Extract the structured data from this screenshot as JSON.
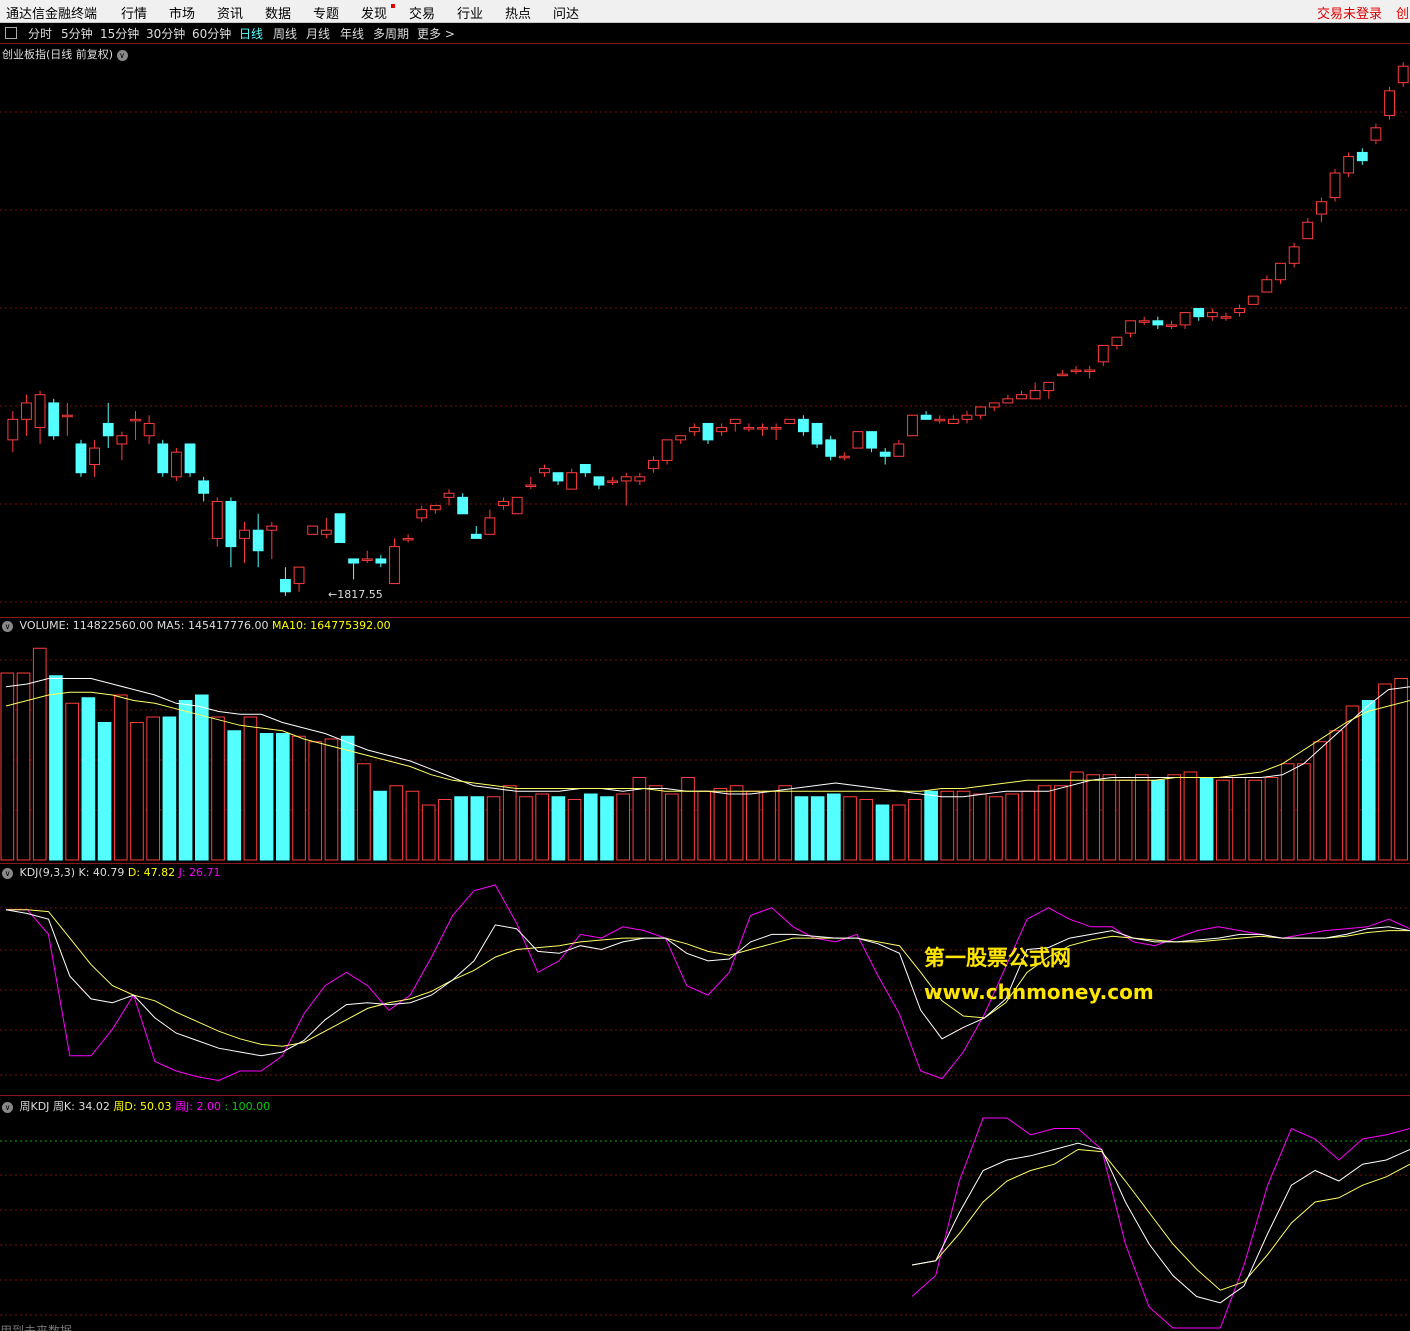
{
  "menubar": {
    "app_title": "通达信金融终端",
    "items": [
      "行情",
      "市场",
      "资讯",
      "数据",
      "专题",
      "发现",
      "交易",
      "行业",
      "热点",
      "问达"
    ],
    "login": "交易未登录",
    "right_cut": "创业"
  },
  "periods": {
    "items": [
      "分时",
      "5分钟",
      "15分钟",
      "30分钟",
      "60分钟",
      "日线",
      "周线",
      "月线",
      "年线",
      "多周期",
      "更多 >"
    ],
    "active": "日线"
  },
  "main_pane": {
    "title": "创业板指(日线 前复权)",
    "low_label": "←1817.55"
  },
  "volume_pane": {
    "label": "VOLUME: 114822560.00",
    "ma5": "MA5: 145417776.00",
    "ma10": "MA10: 164775392.00"
  },
  "kdj_pane": {
    "label": "KDJ(9,3,3)",
    "k": "K: 40.79",
    "d": "D: 47.82",
    "j": "J: 26.71"
  },
  "weekly_kdj_pane": {
    "label": "周KDJ",
    "k": "周K: 34.02",
    "d": "周D: 50.03",
    "j": "周J: 2.00",
    "ref": ": 100.00"
  },
  "watermark": {
    "line1": "第一股票公式网",
    "line2": "www.chnmoney.com"
  },
  "statusbar": {
    "text": "用到未来数据"
  },
  "colors": {
    "up": "#ff3c3c",
    "down": "#54ffff",
    "k_line": "#ffffff",
    "d_line": "#ffff66",
    "j_line": "#ff00ff",
    "grid": "#7a1010",
    "ref_line": "#00aa00"
  },
  "chart_data": [
    {
      "type": "candlestick",
      "name": "price",
      "low_annotation": 1817.55,
      "candles": [
        [
          0.57,
          0.62,
          0.64,
          0.54
        ],
        [
          0.62,
          0.66,
          0.68,
          0.58
        ],
        [
          0.6,
          0.68,
          0.69,
          0.56
        ],
        [
          0.66,
          0.58,
          0.67,
          0.57
        ],
        [
          0.63,
          0.63,
          0.66,
          0.58
        ],
        [
          0.56,
          0.49,
          0.57,
          0.48
        ],
        [
          0.51,
          0.55,
          0.57,
          0.48
        ],
        [
          0.61,
          0.58,
          0.66,
          0.55
        ],
        [
          0.56,
          0.58,
          0.59,
          0.52
        ],
        [
          0.62,
          0.62,
          0.64,
          0.57
        ],
        [
          0.58,
          0.61,
          0.63,
          0.56
        ],
        [
          0.56,
          0.49,
          0.57,
          0.48
        ],
        [
          0.48,
          0.54,
          0.55,
          0.47
        ],
        [
          0.56,
          0.49,
          0.56,
          0.48
        ],
        [
          0.47,
          0.44,
          0.48,
          0.42
        ],
        [
          0.33,
          0.42,
          0.43,
          0.31
        ],
        [
          0.42,
          0.31,
          0.43,
          0.26
        ],
        [
          0.33,
          0.35,
          0.37,
          0.27
        ],
        [
          0.35,
          0.3,
          0.39,
          0.26
        ],
        [
          0.35,
          0.36,
          0.37,
          0.28
        ],
        [
          0.23,
          0.2,
          0.26,
          0.19
        ],
        [
          0.22,
          0.26,
          0.26,
          0.2
        ],
        [
          0.34,
          0.36,
          0.36,
          0.34
        ],
        [
          0.34,
          0.35,
          0.38,
          0.33
        ],
        [
          0.39,
          0.32,
          0.39,
          0.32
        ],
        [
          0.28,
          0.27,
          0.28,
          0.23
        ],
        [
          0.28,
          0.28,
          0.3,
          0.27
        ],
        [
          0.28,
          0.27,
          0.29,
          0.26
        ],
        [
          0.22,
          0.31,
          0.33,
          0.22
        ],
        [
          0.33,
          0.33,
          0.34,
          0.32
        ],
        [
          0.38,
          0.4,
          0.41,
          0.37
        ],
        [
          0.4,
          0.41,
          0.41,
          0.39
        ],
        [
          0.43,
          0.44,
          0.45,
          0.41
        ],
        [
          0.43,
          0.39,
          0.44,
          0.39
        ],
        [
          0.34,
          0.33,
          0.36,
          0.33
        ],
        [
          0.34,
          0.38,
          0.4,
          0.34
        ],
        [
          0.41,
          0.42,
          0.43,
          0.4
        ],
        [
          0.39,
          0.43,
          0.43,
          0.39
        ],
        [
          0.46,
          0.46,
          0.48,
          0.45
        ],
        [
          0.49,
          0.5,
          0.51,
          0.48
        ],
        [
          0.49,
          0.47,
          0.49,
          0.46
        ],
        [
          0.45,
          0.49,
          0.5,
          0.45
        ],
        [
          0.51,
          0.49,
          0.51,
          0.48
        ],
        [
          0.48,
          0.46,
          0.48,
          0.45
        ],
        [
          0.47,
          0.47,
          0.48,
          0.46
        ],
        [
          0.47,
          0.48,
          0.49,
          0.41
        ],
        [
          0.47,
          0.48,
          0.49,
          0.46
        ],
        [
          0.5,
          0.52,
          0.53,
          0.49
        ],
        [
          0.52,
          0.57,
          0.57,
          0.51
        ],
        [
          0.57,
          0.58,
          0.58,
          0.56
        ],
        [
          0.59,
          0.6,
          0.61,
          0.58
        ],
        [
          0.61,
          0.57,
          0.61,
          0.56
        ],
        [
          0.59,
          0.6,
          0.61,
          0.58
        ],
        [
          0.61,
          0.62,
          0.62,
          0.59
        ],
        [
          0.6,
          0.6,
          0.61,
          0.59
        ],
        [
          0.6,
          0.6,
          0.61,
          0.58
        ],
        [
          0.6,
          0.6,
          0.61,
          0.57
        ],
        [
          0.61,
          0.62,
          0.62,
          0.61
        ],
        [
          0.62,
          0.59,
          0.63,
          0.58
        ],
        [
          0.61,
          0.56,
          0.61,
          0.55
        ],
        [
          0.57,
          0.53,
          0.58,
          0.52
        ],
        [
          0.53,
          0.53,
          0.54,
          0.52
        ],
        [
          0.55,
          0.59,
          0.59,
          0.55
        ],
        [
          0.59,
          0.55,
          0.59,
          0.54
        ],
        [
          0.54,
          0.53,
          0.55,
          0.51
        ],
        [
          0.53,
          0.56,
          0.57,
          0.53
        ],
        [
          0.58,
          0.63,
          0.63,
          0.58
        ],
        [
          0.63,
          0.62,
          0.64,
          0.62
        ],
        [
          0.62,
          0.62,
          0.63,
          0.61
        ],
        [
          0.61,
          0.62,
          0.63,
          0.61
        ],
        [
          0.62,
          0.63,
          0.64,
          0.61
        ],
        [
          0.63,
          0.65,
          0.65,
          0.62
        ],
        [
          0.65,
          0.66,
          0.66,
          0.64
        ],
        [
          0.66,
          0.67,
          0.68,
          0.66
        ],
        [
          0.67,
          0.68,
          0.69,
          0.67
        ],
        [
          0.67,
          0.69,
          0.71,
          0.67
        ],
        [
          0.69,
          0.71,
          0.71,
          0.67
        ],
        [
          0.73,
          0.73,
          0.74,
          0.73
        ],
        [
          0.74,
          0.74,
          0.75,
          0.73
        ],
        [
          0.74,
          0.74,
          0.75,
          0.72
        ],
        [
          0.76,
          0.8,
          0.8,
          0.75
        ],
        [
          0.8,
          0.82,
          0.82,
          0.79
        ],
        [
          0.83,
          0.86,
          0.86,
          0.82
        ],
        [
          0.86,
          0.86,
          0.87,
          0.85
        ],
        [
          0.86,
          0.85,
          0.87,
          0.84
        ],
        [
          0.85,
          0.85,
          0.86,
          0.84
        ],
        [
          0.85,
          0.88,
          0.88,
          0.84
        ],
        [
          0.89,
          0.87,
          0.89,
          0.86
        ],
        [
          0.87,
          0.88,
          0.89,
          0.86
        ],
        [
          0.87,
          0.87,
          0.88,
          0.86
        ],
        [
          0.88,
          0.89,
          0.9,
          0.87
        ],
        [
          0.9,
          0.92,
          0.92,
          0.9
        ],
        [
          0.93,
          0.96,
          0.97,
          0.93
        ],
        [
          0.96,
          1.0,
          1.0,
          0.95
        ],
        [
          1.0,
          1.04,
          1.05,
          0.99
        ],
        [
          1.06,
          1.1,
          1.11,
          1.06
        ],
        [
          1.12,
          1.15,
          1.16,
          1.1
        ],
        [
          1.16,
          1.22,
          1.23,
          1.15
        ],
        [
          1.22,
          1.26,
          1.27,
          1.21
        ],
        [
          1.27,
          1.25,
          1.28,
          1.24
        ],
        [
          1.3,
          1.33,
          1.34,
          1.29
        ],
        [
          1.36,
          1.42,
          1.43,
          1.35
        ],
        [
          1.44,
          1.48,
          1.49,
          1.43
        ]
      ]
    },
    {
      "type": "bar",
      "name": "volume",
      "values": [
        0.68,
        0.68,
        0.77,
        0.67,
        0.57,
        0.59,
        0.5,
        0.6,
        0.5,
        0.52,
        0.52,
        0.58,
        0.6,
        0.52,
        0.47,
        0.52,
        0.46,
        0.46,
        0.45,
        0.43,
        0.44,
        0.45,
        0.35,
        0.25,
        0.27,
        0.25,
        0.2,
        0.22,
        0.23,
        0.23,
        0.23,
        0.27,
        0.23,
        0.24,
        0.23,
        0.22,
        0.24,
        0.23,
        0.24,
        0.3,
        0.27,
        0.24,
        0.3,
        0.25,
        0.26,
        0.27,
        0.25,
        0.25,
        0.27,
        0.23,
        0.23,
        0.24,
        0.23,
        0.22,
        0.2,
        0.2,
        0.22,
        0.25,
        0.25,
        0.25,
        0.24,
        0.23,
        0.24,
        0.25,
        0.27,
        0.27,
        0.32,
        0.31,
        0.31,
        0.29,
        0.31,
        0.29,
        0.31,
        0.32,
        0.3,
        0.29,
        0.3,
        0.29,
        0.3,
        0.35,
        0.35,
        0.43,
        0.47,
        0.56,
        0.58,
        0.64,
        0.66
      ],
      "ma5_points": [
        0.63,
        0.64,
        0.66,
        0.66,
        0.66,
        0.64,
        0.62,
        0.6,
        0.57,
        0.56,
        0.54,
        0.53,
        0.53,
        0.5,
        0.48,
        0.46,
        0.43,
        0.4,
        0.38,
        0.36,
        0.33,
        0.3,
        0.27,
        0.26,
        0.25,
        0.25,
        0.25,
        0.26,
        0.26,
        0.25,
        0.26,
        0.26,
        0.25,
        0.25,
        0.24,
        0.24,
        0.25,
        0.26,
        0.27,
        0.28,
        0.27,
        0.26,
        0.25,
        0.24,
        0.23,
        0.23,
        0.24,
        0.25,
        0.25,
        0.25,
        0.27,
        0.29,
        0.3,
        0.3,
        0.3,
        0.3,
        0.3,
        0.3,
        0.3,
        0.3,
        0.31,
        0.35,
        0.42,
        0.49,
        0.56,
        0.62,
        0.63
      ],
      "ma10_points": [
        0.56,
        0.58,
        0.6,
        0.61,
        0.61,
        0.6,
        0.58,
        0.57,
        0.55,
        0.53,
        0.51,
        0.49,
        0.48,
        0.47,
        0.44,
        0.42,
        0.4,
        0.38,
        0.36,
        0.34,
        0.31,
        0.29,
        0.28,
        0.27,
        0.26,
        0.26,
        0.26,
        0.26,
        0.26,
        0.26,
        0.26,
        0.25,
        0.25,
        0.25,
        0.25,
        0.25,
        0.25,
        0.25,
        0.25,
        0.25,
        0.25,
        0.25,
        0.25,
        0.25,
        0.26,
        0.26,
        0.27,
        0.28,
        0.29,
        0.29,
        0.29,
        0.29,
        0.29,
        0.29,
        0.29,
        0.3,
        0.3,
        0.3,
        0.31,
        0.32,
        0.35,
        0.4,
        0.45,
        0.5,
        0.54,
        0.56,
        0.58
      ]
    },
    {
      "type": "line",
      "name": "kdj",
      "k": [
        0.95,
        0.93,
        0.9,
        0.6,
        0.48,
        0.46,
        0.5,
        0.38,
        0.3,
        0.26,
        0.22,
        0.2,
        0.18,
        0.2,
        0.26,
        0.37,
        0.45,
        0.46,
        0.45,
        0.46,
        0.5,
        0.58,
        0.68,
        0.87,
        0.85,
        0.73,
        0.72,
        0.76,
        0.74,
        0.78,
        0.8,
        0.8,
        0.72,
        0.68,
        0.69,
        0.78,
        0.82,
        0.82,
        0.81,
        0.8,
        0.8,
        0.77,
        0.72,
        0.42,
        0.27,
        0.33,
        0.38,
        0.48,
        0.74,
        0.75,
        0.8,
        0.82,
        0.84,
        0.8,
        0.78,
        0.78,
        0.79,
        0.8,
        0.82,
        0.82,
        0.8,
        0.8,
        0.8,
        0.82,
        0.85,
        0.86,
        0.84
      ],
      "d": [
        0.95,
        0.95,
        0.94,
        0.8,
        0.66,
        0.55,
        0.5,
        0.47,
        0.41,
        0.36,
        0.31,
        0.27,
        0.24,
        0.23,
        0.25,
        0.31,
        0.37,
        0.43,
        0.46,
        0.48,
        0.52,
        0.58,
        0.63,
        0.7,
        0.74,
        0.75,
        0.76,
        0.78,
        0.79,
        0.8,
        0.8,
        0.8,
        0.77,
        0.73,
        0.71,
        0.74,
        0.77,
        0.8,
        0.8,
        0.8,
        0.8,
        0.78,
        0.76,
        0.62,
        0.47,
        0.39,
        0.38,
        0.46,
        0.62,
        0.7,
        0.76,
        0.79,
        0.81,
        0.8,
        0.79,
        0.78,
        0.78,
        0.79,
        0.8,
        0.81,
        0.8,
        0.8,
        0.8,
        0.81,
        0.83,
        0.84,
        0.84
      ],
      "j": [
        0.95,
        0.95,
        0.82,
        0.18,
        0.18,
        0.32,
        0.5,
        0.15,
        0.1,
        0.07,
        0.05,
        0.1,
        0.1,
        0.18,
        0.4,
        0.55,
        0.62,
        0.55,
        0.42,
        0.5,
        0.7,
        0.92,
        1.05,
        1.08,
        0.88,
        0.62,
        0.68,
        0.82,
        0.8,
        0.86,
        0.84,
        0.8,
        0.55,
        0.5,
        0.62,
        0.92,
        0.96,
        0.86,
        0.8,
        0.78,
        0.82,
        0.6,
        0.4,
        0.1,
        0.06,
        0.2,
        0.4,
        0.65,
        0.9,
        0.96,
        0.9,
        0.86,
        0.86,
        0.78,
        0.76,
        0.8,
        0.84,
        0.86,
        0.84,
        0.82,
        0.8,
        0.82,
        0.84,
        0.85,
        0.86,
        0.9,
        0.85
      ]
    },
    {
      "type": "line",
      "name": "weekly_kdj",
      "ref_level": 100.0,
      "k": [
        0.3,
        0.32,
        0.55,
        0.75,
        0.8,
        0.82,
        0.85,
        0.88,
        0.85,
        0.6,
        0.4,
        0.25,
        0.15,
        0.12,
        0.2,
        0.45,
        0.68,
        0.75,
        0.7,
        0.78,
        0.8,
        0.85
      ],
      "d": [
        0.3,
        0.32,
        0.45,
        0.6,
        0.7,
        0.75,
        0.78,
        0.85,
        0.84,
        0.7,
        0.55,
        0.4,
        0.28,
        0.18,
        0.22,
        0.35,
        0.5,
        0.6,
        0.62,
        0.68,
        0.72,
        0.78
      ],
      "j": [
        0.15,
        0.25,
        0.7,
        1.0,
        1.0,
        0.92,
        0.95,
        0.95,
        0.85,
        0.4,
        0.1,
        0.0,
        0.0,
        0.0,
        0.3,
        0.68,
        0.95,
        0.9,
        0.8,
        0.9,
        0.92,
        0.95
      ]
    }
  ]
}
